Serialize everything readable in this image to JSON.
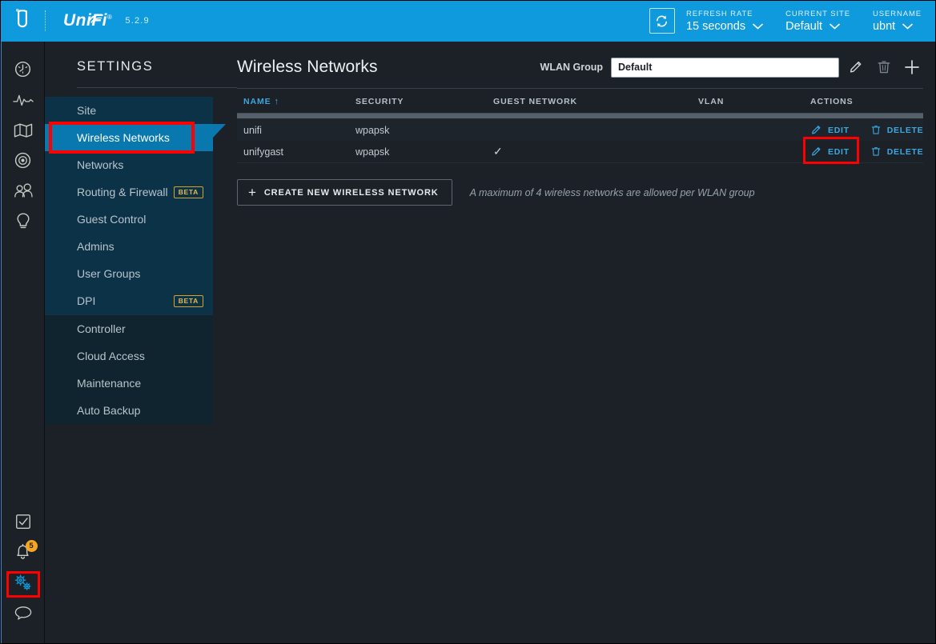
{
  "topbar": {
    "brand": "UniFi",
    "brand_reg": "®",
    "version": "5.2.9",
    "refresh_icon": "refresh-icon",
    "refresh": {
      "label": "REFRESH RATE",
      "value": "15 seconds"
    },
    "site": {
      "label": "CURRENT SITE",
      "value": "Default"
    },
    "user": {
      "label": "USERNAME",
      "value": "ubnt"
    }
  },
  "rail": {
    "top_items": [
      {
        "name": "dashboard-icon",
        "title": "Dashboard"
      },
      {
        "name": "statistics-icon",
        "title": "Statistics"
      },
      {
        "name": "map-icon",
        "title": "Map"
      },
      {
        "name": "devices-icon",
        "title": "Devices"
      },
      {
        "name": "clients-icon",
        "title": "Clients"
      },
      {
        "name": "insights-icon",
        "title": "Insights"
      }
    ],
    "bottom_items": [
      {
        "name": "events-icon",
        "title": "Events",
        "badge": ""
      },
      {
        "name": "alerts-bell-icon",
        "title": "Alerts",
        "badge": "5"
      },
      {
        "name": "settings-gears-icon",
        "title": "Settings",
        "badge": "",
        "active": true,
        "highlighted": true
      },
      {
        "name": "chat-icon",
        "title": "Chat",
        "badge": ""
      }
    ]
  },
  "settings": {
    "title": "Settings",
    "group1": [
      {
        "label": "Site"
      },
      {
        "label": "Wireless Networks",
        "active": true,
        "highlighted": true
      },
      {
        "label": "Networks"
      },
      {
        "label": "Routing & Firewall",
        "badge": "BETA"
      },
      {
        "label": "Guest Control"
      },
      {
        "label": "Admins"
      },
      {
        "label": "User Groups"
      },
      {
        "label": "DPI",
        "badge": "BETA"
      }
    ],
    "group2": [
      {
        "label": "Controller"
      },
      {
        "label": "Cloud Access"
      },
      {
        "label": "Maintenance"
      },
      {
        "label": "Auto Backup"
      }
    ]
  },
  "main": {
    "page_title": "Wireless Networks",
    "wlan_group": {
      "label": "WLAN Group",
      "value": "Default",
      "placeholder": "",
      "edit_icon": "pencil-icon",
      "delete_icon": "trash-icon",
      "add_icon": "plus-icon"
    },
    "table": {
      "columns": [
        {
          "key": "name",
          "label": "NAME",
          "sorted": true,
          "sort_arrow": "↑"
        },
        {
          "key": "security",
          "label": "SECURITY",
          "sorted": false
        },
        {
          "key": "guest",
          "label": "GUEST NETWORK",
          "sorted": false
        },
        {
          "key": "vlan",
          "label": "VLAN",
          "sorted": false
        },
        {
          "key": "actions",
          "label": "ACTIONS",
          "sorted": false
        }
      ],
      "rows": [
        {
          "name": "unifi",
          "security": "wpapsk",
          "guest": "",
          "vlan": "",
          "edit_label": "EDIT",
          "delete_label": "DELETE",
          "edit_highlighted": false
        },
        {
          "name": "unifygast",
          "security": "wpapsk",
          "guest": "✓",
          "vlan": "",
          "edit_label": "EDIT",
          "delete_label": "DELETE",
          "edit_highlighted": true
        }
      ]
    },
    "create_button": "Create New Wireless Network",
    "create_plus": "+",
    "max_hint": "A maximum of 4 wireless networks are allowed per WLAN group"
  },
  "colors": {
    "accent_blue": "#0e9add",
    "link_blue": "#3ca7e0",
    "active_menu": "#0878ae",
    "menu_group_bg": "#0b3247",
    "badge_orange": "#f5a623",
    "beta_yellow": "#e9b949",
    "annotation_red": "#ff0000",
    "page_bg": "#1b2127"
  }
}
